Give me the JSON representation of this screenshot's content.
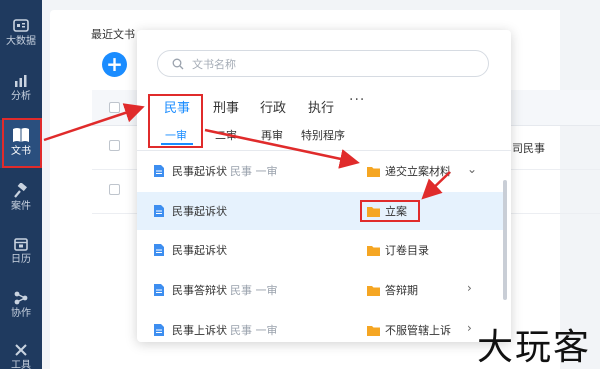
{
  "sidebar": {
    "items": [
      {
        "label": "大数据",
        "icon": "dashboard-icon"
      },
      {
        "label": "分析",
        "icon": "chart-icon"
      },
      {
        "label": "文书",
        "icon": "book-icon",
        "active": true
      },
      {
        "label": "案件",
        "icon": "gavel-icon"
      },
      {
        "label": "日历",
        "icon": "calendar-icon"
      },
      {
        "label": "协作",
        "icon": "share-icon"
      },
      {
        "label": "工具",
        "icon": "tools-icon"
      }
    ]
  },
  "main": {
    "recent_title": "最近文书",
    "row1_text": "司民事"
  },
  "popup": {
    "search_placeholder": "文书名称",
    "tabs": [
      "民事",
      "刑事",
      "行政",
      "执行"
    ],
    "more": "···",
    "subtabs": [
      "一审",
      "二审",
      "再审",
      "特别程序"
    ],
    "rows": [
      {
        "name": "民事起诉状",
        "tag": "民事 一审",
        "folder": "递交立案材料",
        "chevron": "⌄"
      },
      {
        "name": "民事起诉状",
        "tag": "",
        "folder": "立案",
        "chevron": ""
      },
      {
        "name": "民事起诉状",
        "tag": "",
        "folder": "订卷目录",
        "chevron": ""
      },
      {
        "name": "民事答辩状",
        "tag": "民事 一审",
        "folder": "答辩期",
        "chevron": "›"
      },
      {
        "name": "民事上诉状",
        "tag": "民事 一审",
        "folder": "不服管辖上诉",
        "chevron": "›"
      }
    ]
  },
  "watermark": "大玩客",
  "colors": {
    "sidebar": "#1f3a5f",
    "accent": "#1a8cff",
    "folder": "#f5a623",
    "highlight": "#e02b2b"
  }
}
